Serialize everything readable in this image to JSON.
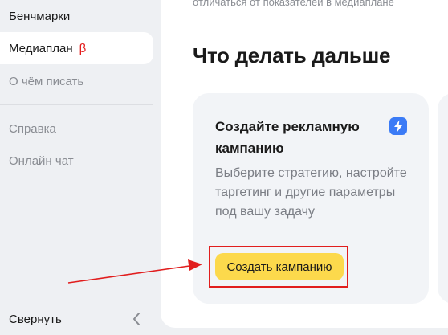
{
  "sidebar": {
    "items": [
      {
        "label": "Бенчмарки"
      },
      {
        "label": "Медиаплан",
        "badge": "β"
      },
      {
        "label": "О чём писать"
      },
      {
        "label": "Справка"
      },
      {
        "label": "Онлайн чат"
      }
    ],
    "collapse_label": "Свернуть"
  },
  "main": {
    "top_text": "отличаться от показателей в медиаплане",
    "section_title": "Что делать дальше",
    "card": {
      "title": "Создайте рекламную кампанию",
      "description": "Выберите стратегию, настройте таргетинг и другие параметры под вашу задачу",
      "button_label": "Создать кампанию",
      "icon": "lightning-icon"
    }
  },
  "colors": {
    "accent_button": "#fcd94c",
    "badge_red": "#e31b1b",
    "icon_blue": "#3b7bf6",
    "annotation_red": "#e11d1d"
  }
}
